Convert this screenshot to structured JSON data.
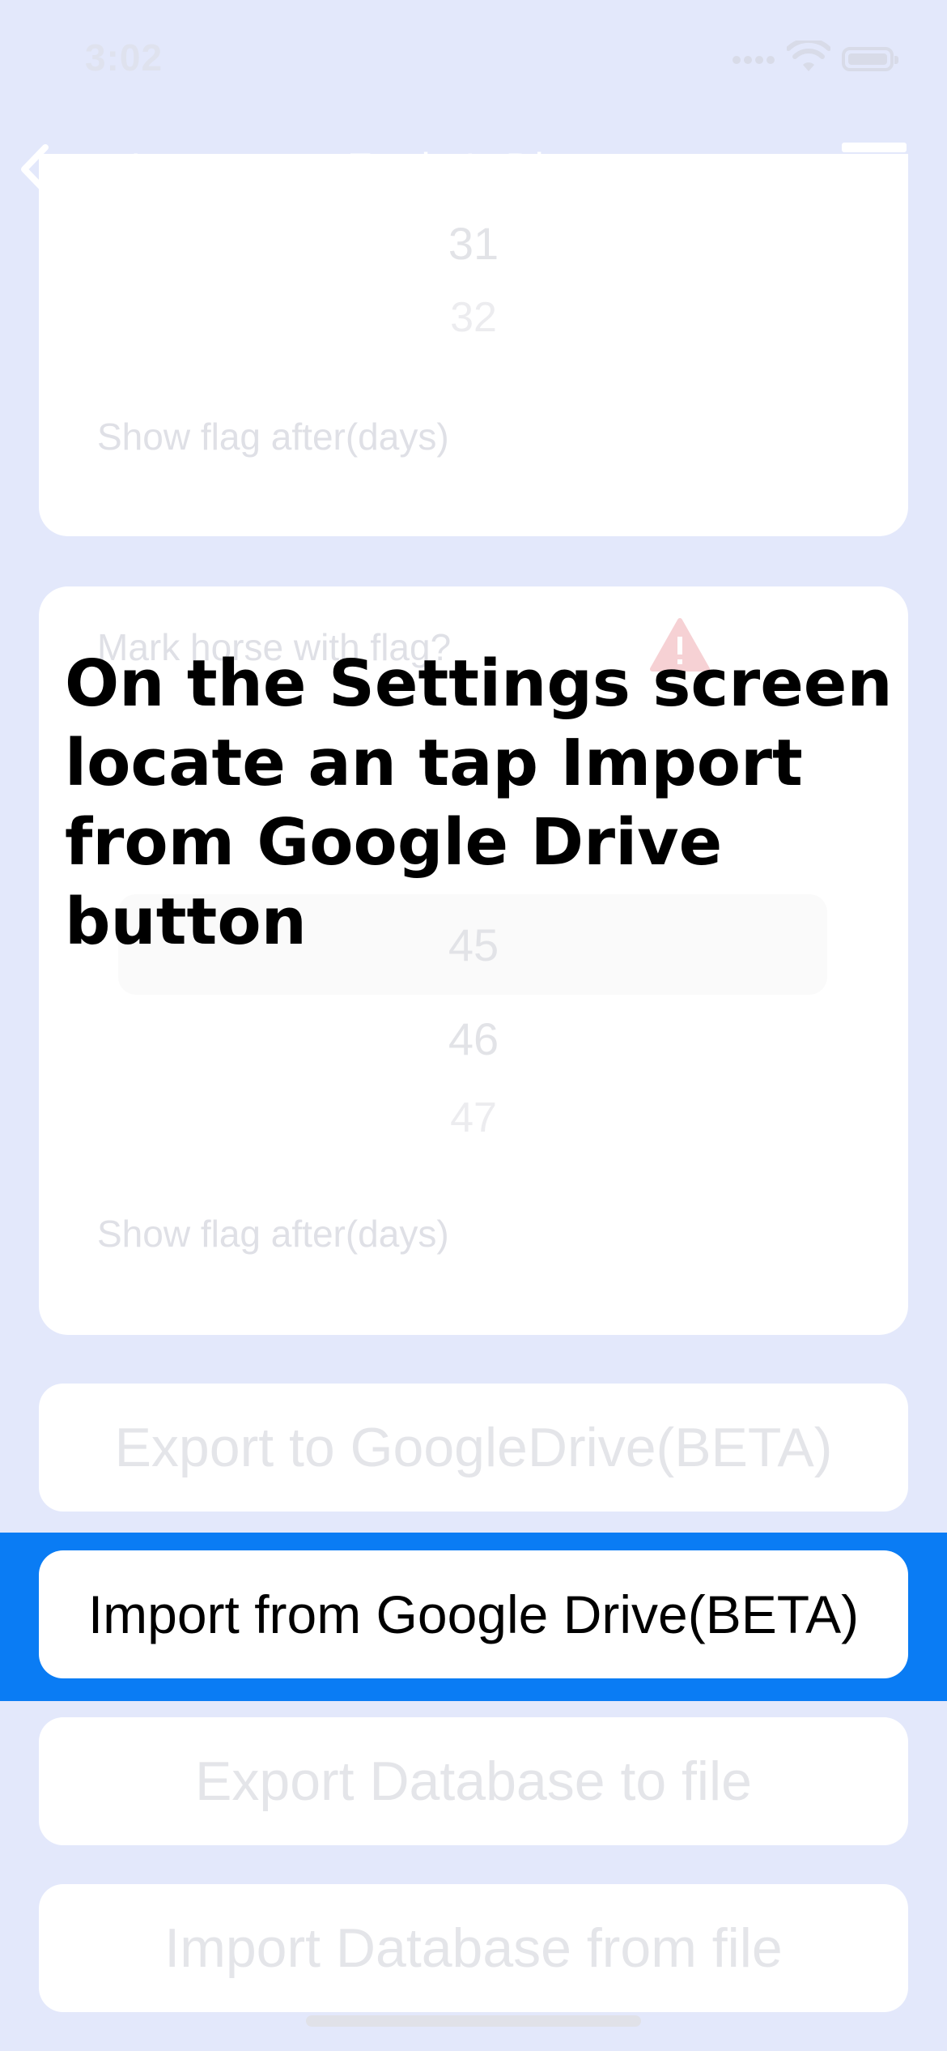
{
  "status_bar": {
    "time": "3:02"
  },
  "nav": {
    "back_label": "Back",
    "title": "Farrier's Diary"
  },
  "card_top": {
    "picker_values": [
      "31",
      "32"
    ],
    "label": "Show flag after(days)"
  },
  "card_bottom": {
    "mark_flag_label": "Mark horse with flag?",
    "picker_values": [
      "45",
      "46",
      "47"
    ],
    "label": "Show flag after(days)"
  },
  "buttons": {
    "export_google": "Export to GoogleDrive(BETA)",
    "import_google": "Import from Google Drive(BETA)",
    "export_db": "Export Database to file",
    "import_db": "Import Database from file"
  },
  "instruction": "On the Settings screen locate an tap Import from Google Drive button",
  "colors": {
    "background": "#e3e8fb",
    "highlight": "#0a7cf4"
  }
}
